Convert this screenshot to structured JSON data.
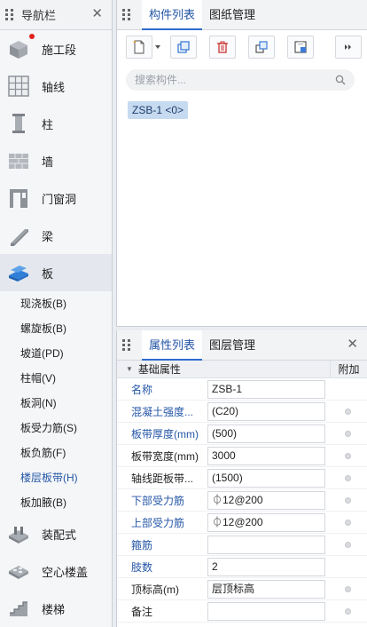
{
  "nav": {
    "title": "导航栏",
    "items": [
      {
        "label": "施工段",
        "icon": "construction-section-icon"
      },
      {
        "label": "轴线",
        "icon": "axis-grid-icon"
      },
      {
        "label": "柱",
        "icon": "column-icon"
      },
      {
        "label": "墙",
        "icon": "wall-icon"
      },
      {
        "label": "门窗洞",
        "icon": "door-window-icon"
      },
      {
        "label": "梁",
        "icon": "beam-icon"
      },
      {
        "label": "板",
        "icon": "slab-icon"
      }
    ],
    "sub_items": [
      {
        "label": "现浇板(B)"
      },
      {
        "label": "螺旋板(B)"
      },
      {
        "label": "坡道(PD)"
      },
      {
        "label": "柱帽(V)"
      },
      {
        "label": "板洞(N)"
      },
      {
        "label": "板受力筋(S)"
      },
      {
        "label": "板负筋(F)"
      },
      {
        "label": "楼层板带(H)"
      },
      {
        "label": "板加腋(B)"
      }
    ],
    "bottom_items": [
      {
        "label": "装配式",
        "icon": "prefab-icon"
      },
      {
        "label": "空心楼盖",
        "icon": "hollow-floor-icon"
      },
      {
        "label": "楼梯",
        "icon": "stairs-icon"
      }
    ]
  },
  "component_panel": {
    "tabs": [
      "构件列表",
      "图纸管理"
    ],
    "search_placeholder": "搜索构件...",
    "selected_component": "ZSB-1 <0>"
  },
  "property_panel": {
    "tabs": [
      "属性列表",
      "图层管理"
    ],
    "group_label": "基础属性",
    "extra_header": "附加",
    "rows": [
      {
        "name": "名称",
        "value": "ZSB-1"
      },
      {
        "name": "混凝土强度...",
        "value": "(C20)"
      },
      {
        "name": "板带厚度(mm)",
        "value": "(500)"
      },
      {
        "name": "板带宽度(mm)",
        "value": "3000"
      },
      {
        "name": "轴线距板带...",
        "value": "(1500)"
      },
      {
        "name": "下部受力筋",
        "value": "⏀12@200"
      },
      {
        "name": "上部受力筋",
        "value": "⏀12@200"
      },
      {
        "name": "箍筋",
        "value": ""
      },
      {
        "name": "肢数",
        "value": "2"
      },
      {
        "name": "顶标高(m)",
        "value": "层顶标高"
      },
      {
        "name": "备注",
        "value": ""
      }
    ]
  },
  "colors": {
    "accent": "#2f6bd0",
    "selected_text": "#2456a6",
    "chip_bg": "#c6daf0"
  }
}
